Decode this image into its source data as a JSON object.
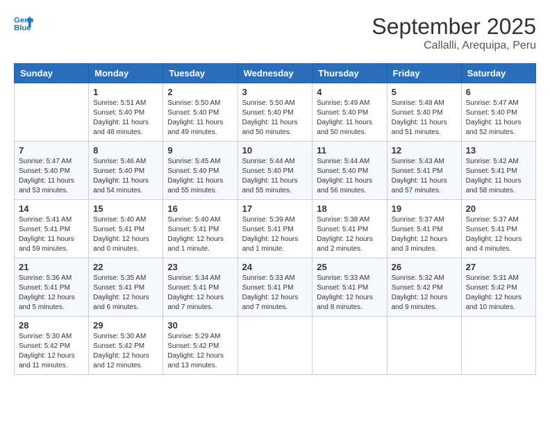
{
  "header": {
    "logo_line1": "General",
    "logo_line2": "Blue",
    "month": "September 2025",
    "location": "Callalli, Arequipa, Peru"
  },
  "weekdays": [
    "Sunday",
    "Monday",
    "Tuesday",
    "Wednesday",
    "Thursday",
    "Friday",
    "Saturday"
  ],
  "weeks": [
    [
      {
        "day": "",
        "info": ""
      },
      {
        "day": "1",
        "info": "Sunrise: 5:51 AM\nSunset: 5:40 PM\nDaylight: 11 hours\nand 48 minutes."
      },
      {
        "day": "2",
        "info": "Sunrise: 5:50 AM\nSunset: 5:40 PM\nDaylight: 11 hours\nand 49 minutes."
      },
      {
        "day": "3",
        "info": "Sunrise: 5:50 AM\nSunset: 5:40 PM\nDaylight: 11 hours\nand 50 minutes."
      },
      {
        "day": "4",
        "info": "Sunrise: 5:49 AM\nSunset: 5:40 PM\nDaylight: 11 hours\nand 50 minutes."
      },
      {
        "day": "5",
        "info": "Sunrise: 5:48 AM\nSunset: 5:40 PM\nDaylight: 11 hours\nand 51 minutes."
      },
      {
        "day": "6",
        "info": "Sunrise: 5:47 AM\nSunset: 5:40 PM\nDaylight: 11 hours\nand 52 minutes."
      }
    ],
    [
      {
        "day": "7",
        "info": "Sunrise: 5:47 AM\nSunset: 5:40 PM\nDaylight: 11 hours\nand 53 minutes."
      },
      {
        "day": "8",
        "info": "Sunrise: 5:46 AM\nSunset: 5:40 PM\nDaylight: 11 hours\nand 54 minutes."
      },
      {
        "day": "9",
        "info": "Sunrise: 5:45 AM\nSunset: 5:40 PM\nDaylight: 11 hours\nand 55 minutes."
      },
      {
        "day": "10",
        "info": "Sunrise: 5:44 AM\nSunset: 5:40 PM\nDaylight: 11 hours\nand 55 minutes."
      },
      {
        "day": "11",
        "info": "Sunrise: 5:44 AM\nSunset: 5:40 PM\nDaylight: 11 hours\nand 56 minutes."
      },
      {
        "day": "12",
        "info": "Sunrise: 5:43 AM\nSunset: 5:41 PM\nDaylight: 11 hours\nand 57 minutes."
      },
      {
        "day": "13",
        "info": "Sunrise: 5:42 AM\nSunset: 5:41 PM\nDaylight: 11 hours\nand 58 minutes."
      }
    ],
    [
      {
        "day": "14",
        "info": "Sunrise: 5:41 AM\nSunset: 5:41 PM\nDaylight: 11 hours\nand 59 minutes."
      },
      {
        "day": "15",
        "info": "Sunrise: 5:40 AM\nSunset: 5:41 PM\nDaylight: 12 hours\nand 0 minutes."
      },
      {
        "day": "16",
        "info": "Sunrise: 5:40 AM\nSunset: 5:41 PM\nDaylight: 12 hours\nand 1 minute."
      },
      {
        "day": "17",
        "info": "Sunrise: 5:39 AM\nSunset: 5:41 PM\nDaylight: 12 hours\nand 1 minute."
      },
      {
        "day": "18",
        "info": "Sunrise: 5:38 AM\nSunset: 5:41 PM\nDaylight: 12 hours\nand 2 minutes."
      },
      {
        "day": "19",
        "info": "Sunrise: 5:37 AM\nSunset: 5:41 PM\nDaylight: 12 hours\nand 3 minutes."
      },
      {
        "day": "20",
        "info": "Sunrise: 5:37 AM\nSunset: 5:41 PM\nDaylight: 12 hours\nand 4 minutes."
      }
    ],
    [
      {
        "day": "21",
        "info": "Sunrise: 5:36 AM\nSunset: 5:41 PM\nDaylight: 12 hours\nand 5 minutes."
      },
      {
        "day": "22",
        "info": "Sunrise: 5:35 AM\nSunset: 5:41 PM\nDaylight: 12 hours\nand 6 minutes."
      },
      {
        "day": "23",
        "info": "Sunrise: 5:34 AM\nSunset: 5:41 PM\nDaylight: 12 hours\nand 7 minutes."
      },
      {
        "day": "24",
        "info": "Sunrise: 5:33 AM\nSunset: 5:41 PM\nDaylight: 12 hours\nand 7 minutes."
      },
      {
        "day": "25",
        "info": "Sunrise: 5:33 AM\nSunset: 5:41 PM\nDaylight: 12 hours\nand 8 minutes."
      },
      {
        "day": "26",
        "info": "Sunrise: 5:32 AM\nSunset: 5:42 PM\nDaylight: 12 hours\nand 9 minutes."
      },
      {
        "day": "27",
        "info": "Sunrise: 5:31 AM\nSunset: 5:42 PM\nDaylight: 12 hours\nand 10 minutes."
      }
    ],
    [
      {
        "day": "28",
        "info": "Sunrise: 5:30 AM\nSunset: 5:42 PM\nDaylight: 12 hours\nand 11 minutes."
      },
      {
        "day": "29",
        "info": "Sunrise: 5:30 AM\nSunset: 5:42 PM\nDaylight: 12 hours\nand 12 minutes."
      },
      {
        "day": "30",
        "info": "Sunrise: 5:29 AM\nSunset: 5:42 PM\nDaylight: 12 hours\nand 13 minutes."
      },
      {
        "day": "",
        "info": ""
      },
      {
        "day": "",
        "info": ""
      },
      {
        "day": "",
        "info": ""
      },
      {
        "day": "",
        "info": ""
      }
    ]
  ]
}
